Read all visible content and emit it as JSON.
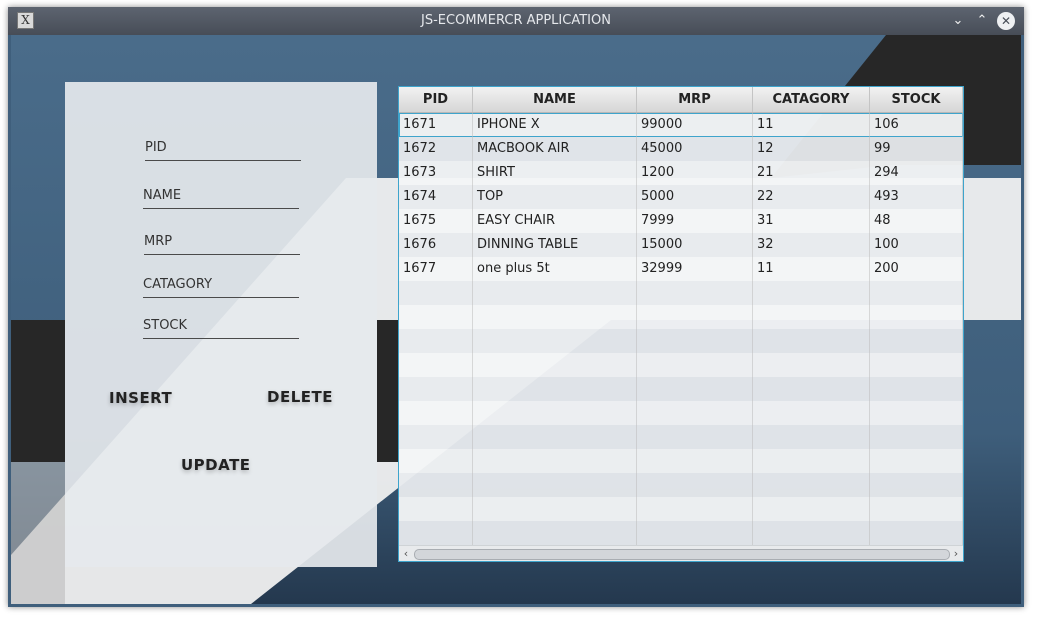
{
  "window": {
    "title": "JS-ECOMMERCR APPLICATION",
    "icon_glyph": "X",
    "minimize_glyph": "⌄",
    "maximize_glyph": "⌃",
    "close_glyph": "✕"
  },
  "form": {
    "pid_placeholder": "PID",
    "name_placeholder": "NAME",
    "mrp_placeholder": "MRP",
    "catagory_placeholder": "CATAGORY",
    "stock_placeholder": "STOCK",
    "insert_label": "INSERT",
    "delete_label": "DELETE",
    "update_label": "UPDATE"
  },
  "table": {
    "headers": [
      "PID",
      "NAME",
      "MRP",
      "CATAGORY",
      "STOCK"
    ],
    "rows": [
      [
        "1671",
        "IPHONE X",
        "99000",
        "11",
        "106"
      ],
      [
        "1672",
        "MACBOOK AIR",
        "45000",
        "12",
        "99"
      ],
      [
        "1673",
        "SHIRT",
        "1200",
        "21",
        "294"
      ],
      [
        "1674",
        "TOP",
        "5000",
        "22",
        "493"
      ],
      [
        "1675",
        "EASY CHAIR",
        "7999",
        "31",
        "48"
      ],
      [
        "1676",
        "DINNING TABLE",
        "15000",
        "32",
        "100"
      ],
      [
        "1677",
        "one plus 5t",
        "32999",
        "11",
        "200"
      ]
    ],
    "selected_row": 0,
    "empty_rows": 11,
    "scroll_left_glyph": "‹",
    "scroll_right_glyph": "›"
  },
  "colors": {
    "accent": "#3ea4cc",
    "background": "#3f5f7c",
    "titlebar": "#474d57"
  }
}
